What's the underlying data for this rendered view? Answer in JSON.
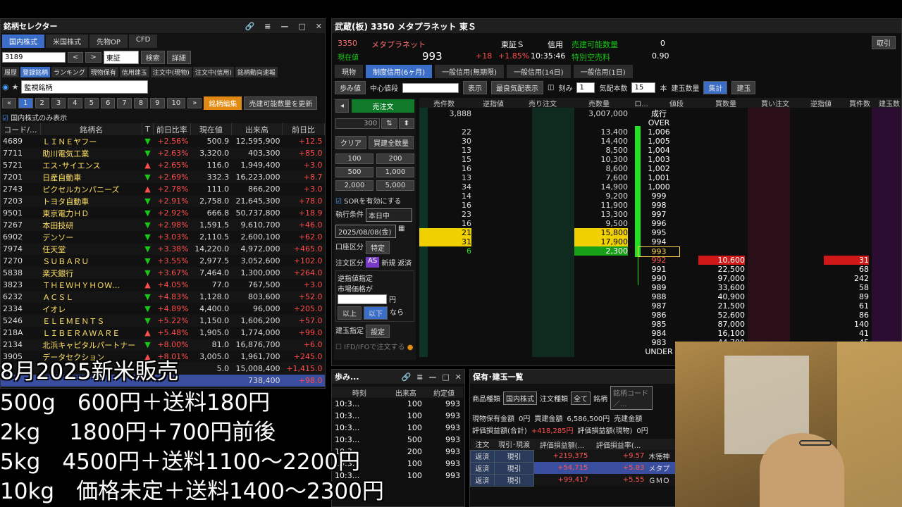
{
  "left_panel": {
    "title": "銘柄セレクター",
    "tabs": [
      "国内株式",
      "米国株式",
      "先物OP",
      "CFD"
    ],
    "code_input": "3189",
    "market_select": "東証",
    "search_btn": "検索",
    "detail_btn": "詳細",
    "subtabs": [
      "履歴",
      "登録銘柄",
      "ランキング",
      "現物保有",
      "信用建玉",
      "注文中(現物)",
      "注文中(信用)",
      "銘柄動向速報"
    ],
    "list_select": "監視銘柄",
    "pages": [
      "1",
      "2",
      "3",
      "4",
      "5",
      "6",
      "7",
      "8",
      "9",
      "10"
    ],
    "edit_btn": "銘柄編集",
    "update_btn": "売建可能数量を更新",
    "domestic_only": "国内株式のみ表示",
    "columns": [
      "コード/...",
      "銘柄名",
      "T",
      "前日比率",
      "現在値",
      "出来高",
      "前日比"
    ],
    "rows": [
      {
        "code": "4689",
        "name": "ＬＩＮＥヤフー",
        "t": "▼",
        "rate": "+2.56%",
        "price": "500.9",
        "vol": "12,595,900",
        "chg": "+12.5"
      },
      {
        "code": "7711",
        "name": "助川電気工業",
        "t": "▼",
        "rate": "+2.63%",
        "price": "3,320.0",
        "vol": "403,300",
        "chg": "+85.0"
      },
      {
        "code": "5721",
        "name": "エス･サイエンス",
        "t": "▲",
        "rate": "+2.65%",
        "price": "116.0",
        "vol": "1,949,400",
        "chg": "+3.0"
      },
      {
        "code": "7201",
        "name": "日産自動車",
        "t": "▼",
        "rate": "+2.69%",
        "price": "332.3",
        "vol": "16,223,000",
        "chg": "+8.7"
      },
      {
        "code": "2743",
        "name": "ピクセルカンパニーズ",
        "t": "▲",
        "rate": "+2.78%",
        "price": "111.0",
        "vol": "866,200",
        "chg": "+3.0"
      },
      {
        "code": "7203",
        "name": "トヨタ自動車",
        "t": "▼",
        "rate": "+2.91%",
        "price": "2,758.0",
        "vol": "21,645,300",
        "chg": "+78.0"
      },
      {
        "code": "9501",
        "name": "東京電力ＨＤ",
        "t": "▼",
        "rate": "+2.92%",
        "price": "666.8",
        "vol": "50,737,800",
        "chg": "+18.9"
      },
      {
        "code": "7267",
        "name": "本田技研",
        "t": "▼",
        "rate": "+2.98%",
        "price": "1,591.5",
        "vol": "9,610,700",
        "chg": "+46.0"
      },
      {
        "code": "6902",
        "name": "デンソー",
        "t": "▼",
        "rate": "+3.03%",
        "price": "2,110.5",
        "vol": "2,600,100",
        "chg": "+62.0"
      },
      {
        "code": "7974",
        "name": "任天堂",
        "t": "▼",
        "rate": "+3.38%",
        "price": "14,220.0",
        "vol": "4,972,000",
        "chg": "+465.0"
      },
      {
        "code": "7270",
        "name": "ＳＵＢＡＲＵ",
        "t": "▼",
        "rate": "+3.55%",
        "price": "2,977.5",
        "vol": "3,052,600",
        "chg": "+102.0"
      },
      {
        "code": "5838",
        "name": "楽天銀行",
        "t": "▼",
        "rate": "+3.67%",
        "price": "7,464.0",
        "vol": "1,300,000",
        "chg": "+264.0"
      },
      {
        "code": "3823",
        "name": "ＴＨＥＷＨＹＨＯＷ...",
        "t": "▲",
        "rate": "+4.05%",
        "price": "77.0",
        "vol": "767,500",
        "chg": "+3.0"
      },
      {
        "code": "6232",
        "name": "ＡＣＳＬ",
        "t": "▼",
        "rate": "+4.83%",
        "price": "1,128.0",
        "vol": "803,600",
        "chg": "+52.0"
      },
      {
        "code": "2334",
        "name": "イオレ",
        "t": "▼",
        "rate": "+4.89%",
        "price": "4,400.0",
        "vol": "96,000",
        "chg": "+205.0"
      },
      {
        "code": "5246",
        "name": "ＥＬＥＭＥＮＴＳ",
        "t": "▼",
        "rate": "+5.22%",
        "price": "1,150.0",
        "vol": "1,606,200",
        "chg": "+57.0"
      },
      {
        "code": "218A",
        "name": "ＬＩＢＥＲＡＷＡＲＥ",
        "t": "▲",
        "rate": "+5.48%",
        "price": "1,905.0",
        "vol": "1,774,000",
        "chg": "+99.0"
      },
      {
        "code": "2134",
        "name": "北浜キャピタルパートナー",
        "t": "▼",
        "rate": "+8.00%",
        "price": "81.0",
        "vol": "16,876,700",
        "chg": "+6.0"
      },
      {
        "code": "3905",
        "name": "データセクション",
        "t": "▲",
        "rate": "+8.01%",
        "price": "3,005.0",
        "vol": "1,961,700",
        "chg": "+245.0"
      },
      {
        "code": "",
        "name": "",
        "t": "",
        "rate": "",
        "price": "5.0",
        "vol": "15,008,400",
        "chg": "+1,415.0"
      },
      {
        "code": "",
        "name": "",
        "t": "",
        "rate": "",
        "price": "",
        "vol": "738,400",
        "chg": "+98.0"
      }
    ]
  },
  "board": {
    "title": "武蔵(板) 3350 メタプラネット 東Ｓ",
    "code": "3350",
    "name": "メタプラネット",
    "price_label": "現在値",
    "price": "993",
    "change": "+18",
    "change_rate": "+1.85%",
    "time": "10:35:46",
    "market": "東証Ｓ",
    "credit": "信用",
    "short_label": "売建可能数量",
    "short_val": "0",
    "special_label": "特別空売料",
    "special_val": "0.90",
    "get_btn": "取引",
    "trade_tabs": [
      "現物",
      "制度信用(6ヶ月)",
      "一般信用(無期限)",
      "一般信用(14日)",
      "一般信用(1日)"
    ],
    "toolbar": {
      "ayumi": "歩み値",
      "center": "中心値段",
      "display": "表示",
      "best": "最良気配表示",
      "tick": "刻み",
      "tick_val": "1",
      "count_label": "気配本数",
      "count_val": "15",
      "unit": "本",
      "tatedama": "建玉数量",
      "aggregate": "集計",
      "tatedama2": "建玉"
    },
    "order": {
      "sell": "売注文",
      "qty": "300",
      "clear": "クリア",
      "buy_all": "買建全数量",
      "q1": "100",
      "q2": "200",
      "q3": "500",
      "q4": "1,000",
      "q5": "2,000",
      "q6": "5,000",
      "sor": "SORを有効にする",
      "cond_label": "執行条件",
      "cond": "本日中",
      "date": "2025/08/08(金)",
      "account_label": "口座区分",
      "account": "特定",
      "type_label": "注文区分",
      "as": "AS",
      "new": "新規",
      "close": "返済",
      "stop_label": "逆指値指定",
      "market_price": "市場価格が",
      "yen": "円",
      "above": "以上",
      "below": "以下",
      "then": "なら",
      "tatedama_label": "建玉指定",
      "setting": "設定",
      "ifd": "IFD/IFOで注文する"
    },
    "columns": [
      "売件数",
      "逆指値",
      "売り注文",
      "売数量",
      "ロ...",
      "値段",
      "買数量",
      "買い注文",
      "逆指値",
      "買件数",
      "建玉数"
    ],
    "asks": [
      {
        "cnt": "3,888",
        "qty": "3,007,000",
        "price": "成行"
      },
      {
        "cnt": "",
        "qty": "",
        "price": "OVER"
      },
      {
        "cnt": "22",
        "qty": "13,400",
        "price": "1,006"
      },
      {
        "cnt": "30",
        "qty": "14,400",
        "price": "1,005"
      },
      {
        "cnt": "13",
        "qty": "8,500",
        "price": "1,004"
      },
      {
        "cnt": "15",
        "qty": "10,300",
        "price": "1,003"
      },
      {
        "cnt": "16",
        "qty": "8,600",
        "price": "1,002"
      },
      {
        "cnt": "13",
        "qty": "7,600",
        "price": "1,001"
      },
      {
        "cnt": "34",
        "qty": "14,900",
        "price": "1,000"
      },
      {
        "cnt": "14",
        "qty": "9,200",
        "price": "999"
      },
      {
        "cnt": "16",
        "qty": "11,900",
        "price": "998"
      },
      {
        "cnt": "23",
        "qty": "13,300",
        "price": "997"
      },
      {
        "cnt": "16",
        "qty": "9,500",
        "price": "996"
      },
      {
        "cnt": "21",
        "qty": "15,800",
        "price": "995"
      },
      {
        "cnt": "31",
        "qty": "17,900",
        "price": "994"
      },
      {
        "cnt": "6",
        "qty": "2,300",
        "price": "993"
      }
    ],
    "bids": [
      {
        "price": "992",
        "qty": "10,600",
        "cnt": "31"
      },
      {
        "price": "991",
        "qty": "22,500",
        "cnt": "68"
      },
      {
        "price": "990",
        "qty": "97,000",
        "cnt": "242"
      },
      {
        "price": "989",
        "qty": "33,600",
        "cnt": "58"
      },
      {
        "price": "988",
        "qty": "40,900",
        "cnt": "89"
      },
      {
        "price": "987",
        "qty": "21,500",
        "cnt": "61"
      },
      {
        "price": "986",
        "qty": "52,600",
        "cnt": "86"
      },
      {
        "price": "985",
        "qty": "87,000",
        "cnt": "140"
      },
      {
        "price": "984",
        "qty": "16,100",
        "cnt": "41"
      },
      {
        "price": "983",
        "qty": "44,700",
        "cnt": "45"
      },
      {
        "price": "UNDER",
        "qty": "",
        "cnt": ""
      }
    ]
  },
  "ayumi": {
    "title": "歩み...",
    "columns": [
      "時刻",
      "出来高",
      "約定値"
    ],
    "rows": [
      {
        "t": "10:3...",
        "v": "100",
        "p": "993"
      },
      {
        "t": "10:3...",
        "v": "100",
        "p": "993"
      },
      {
        "t": "10:3...",
        "v": "100",
        "p": "993"
      },
      {
        "t": "10:3...",
        "v": "500",
        "p": "993"
      },
      {
        "t": "10:3...",
        "v": "200",
        "p": "993"
      },
      {
        "t": "10:3...",
        "v": "100",
        "p": "993"
      },
      {
        "t": "10:3...",
        "v": "100",
        "p": "993"
      }
    ]
  },
  "hoyu": {
    "title": "保有･建玉一覧",
    "product_label": "商品種類",
    "product": "国内株式",
    "order_label": "注文種類",
    "order": "全て",
    "stock_label": "銘柄",
    "stock_placeholder": "銘柄コード／...",
    "cash_label": "現物保有金額",
    "cash": "0円",
    "buy_label": "買建金額",
    "buy": "6,586,500円",
    "sell_label": "売建金額",
    "eval_label": "評価損益額(合計)",
    "eval": "+418,285円",
    "eval_cash_label": "評価損益額(現物)",
    "eval_cash": "0円",
    "columns": [
      "注文",
      "現引･現渡",
      "評価損益額(...",
      "評価損益率(..."
    ],
    "rows": [
      {
        "a": "返済",
        "b": "現引",
        "c": "+219,375",
        "d": "+9.57",
        "e": "木徳神"
      },
      {
        "a": "返済",
        "b": "現引",
        "c": "+54,715",
        "d": "+5.83",
        "e": "メタプ"
      },
      {
        "a": "返済",
        "b": "現引",
        "c": "+99,417",
        "d": "+5.55",
        "e": "ＧＭＯ"
      }
    ]
  },
  "overlay": {
    "line1": "8月2025新米販売",
    "line2": "500g　600円＋送料180円",
    "line3": "2kg　 1800円＋700円前後",
    "line4": "5kg　4500円＋送料1100～2200円",
    "line5": "10kg　価格未定＋送料1400～2300円"
  },
  "colors": {
    "accent": "#3a6ec8",
    "up": "#ff4d4d",
    "buy_blue": "#4da3ff",
    "orange": "#e08a14"
  }
}
